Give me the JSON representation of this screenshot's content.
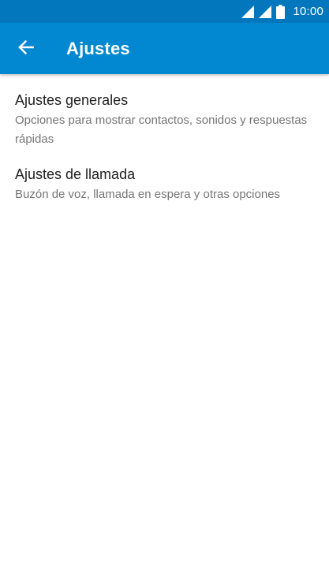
{
  "status_bar": {
    "time": "10:00",
    "icons": [
      "signal-icon",
      "signal-icon",
      "battery-icon"
    ],
    "background_color": "#0277bd"
  },
  "app_bar": {
    "title": "Ajustes",
    "back_icon": "back-arrow-icon",
    "background_color": "#0288d1"
  },
  "settings": {
    "items": [
      {
        "title": "Ajustes generales",
        "summary": "Opciones para mostrar contactos, sonidos y respuestas rápidas"
      },
      {
        "title": "Ajustes de llamada",
        "summary": "Buzón de voz, llamada en espera y otras opciones"
      }
    ]
  }
}
